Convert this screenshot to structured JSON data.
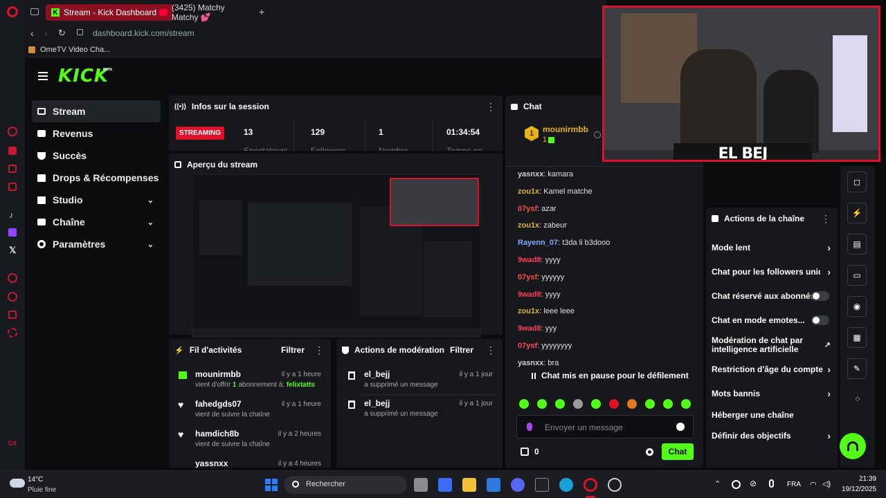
{
  "browser": {
    "tabs": [
      {
        "title": "Stream - Kick Dashboard"
      },
      {
        "title": "(3425) Matchy Matchy 💕"
      }
    ],
    "address": "dashboard.kick.com/stream",
    "bookmark": "OmeTV Video Cha..."
  },
  "kick": {
    "logo": "KICK",
    "logo_badge": "BETA",
    "nav": [
      {
        "label": "Stream",
        "icon": "video-icon"
      },
      {
        "label": "Revenus",
        "icon": "wallet-icon"
      },
      {
        "label": "Succès",
        "icon": "trophy-icon"
      },
      {
        "label": "Drops & Récompenses",
        "icon": "gift-icon"
      },
      {
        "label": "Studio",
        "icon": "layers-icon"
      },
      {
        "label": "Chaîne",
        "icon": "tv-icon"
      },
      {
        "label": "Paramètres",
        "icon": "gear-icon"
      }
    ],
    "session": {
      "title": "Infos sur la session",
      "status": "STREAMING",
      "stats": [
        {
          "value": "13",
          "label": "Spectateurs"
        },
        {
          "value": "129",
          "label": "Followers"
        },
        {
          "value": "1",
          "label": "Nombre"
        },
        {
          "value": "01:34:54",
          "label": "Temps en"
        }
      ]
    },
    "preview": {
      "title": "Aperçu du stream"
    },
    "activity": {
      "title": "Fil d'activités",
      "filter": "Filtrer",
      "items": [
        {
          "name": "mounirmbb",
          "time": "il y a 1 heure",
          "sub_prefix": "vient d'offrir ",
          "sub_count": "1",
          "sub_mid": " abonnement à: ",
          "sub_target": "felixtatts"
        },
        {
          "name": "fahedgds07",
          "time": "il y a 1 heure",
          "sub": "vient de suivre la chaîne"
        },
        {
          "name": "hamdich8b",
          "time": "il y a 2 heures",
          "sub": "vient de suivre la chaîne"
        },
        {
          "name": "yassnxx",
          "time": "il y a 4 heures"
        }
      ]
    },
    "moderation": {
      "title": "Actions de modération",
      "filter": "Filtrer",
      "items": [
        {
          "name": "el_bejj",
          "time": "il y a 1 jour",
          "sub": "a supprimé un message"
        },
        {
          "name": "el_bejj",
          "time": "il y a 1 jour",
          "sub": "a supprimé un message"
        }
      ]
    },
    "chat": {
      "title": "Chat",
      "pinned_user": "mounirmbb",
      "pinned_count": "1",
      "messages": [
        {
          "user": "yasnxx",
          "text": ": kamara",
          "color": "#d0d0d0"
        },
        {
          "user": "zou1x",
          "text": ": Kamel matche",
          "color": "#e0b040"
        },
        {
          "user": "07ysf",
          "text": ": azar",
          "color": "#ff4d4d"
        },
        {
          "user": "zou1x",
          "text": ": zabeur",
          "color": "#e0b040"
        },
        {
          "user": "Rayenn_07",
          "text": ": t3da li b3dooo",
          "color": "#7fa8ff"
        },
        {
          "user": "9wad8",
          "text": ": yyyy",
          "color": "#ff3b5c"
        },
        {
          "user": "07ysf",
          "text": ": yyyyyy",
          "color": "#ff4d4d"
        },
        {
          "user": "9wad8",
          "text": ": yyyy",
          "color": "#ff3b5c"
        },
        {
          "user": "zou1x",
          "text": ": leee leee",
          "color": "#e0b040"
        },
        {
          "user": "9wad8",
          "text": ": yyy",
          "color": "#ff3b5c"
        },
        {
          "user": "07ysf",
          "text": ": yyyyyyyy",
          "color": "#ff4d4d"
        },
        {
          "user": "yasnxx",
          "text": ": bra",
          "color": "#d0d0d0"
        }
      ],
      "paused": "Chat mis en pause pour le défilement",
      "input_placeholder": "Envoyer un message",
      "points": "0",
      "send": "Chat"
    },
    "channel_actions": {
      "title": "Actions de la chaîne",
      "items": [
        {
          "label": "Mode lent",
          "control": "chevron"
        },
        {
          "label": "Chat pour les followers uniquement",
          "control": "chevron"
        },
        {
          "label": "Chat réservé aux abonnés",
          "control": "toggle"
        },
        {
          "label": "Chat en mode emotes...",
          "control": "toggle"
        },
        {
          "label": "Modération de chat par intelligence artificielle",
          "control": "external"
        },
        {
          "label": "Restriction d'âge du compte",
          "control": "chevron"
        },
        {
          "label": "Mots bannis",
          "control": "chevron"
        },
        {
          "label": "Héberger une chaîne",
          "control": "none"
        },
        {
          "label": "Définir des objectifs",
          "control": "chevron"
        }
      ]
    },
    "cam_name": "EL BEJ"
  },
  "taskbar": {
    "weather_temp": "14°C",
    "weather_desc": "Pluie fine",
    "search": "Rechercher",
    "lang": "FRA",
    "time": "21:39",
    "date": "19/12/2025"
  },
  "colors": {
    "kick_green": "#53fc18",
    "streaming_red": "#e0102a",
    "tab_red": "#8a1021"
  }
}
